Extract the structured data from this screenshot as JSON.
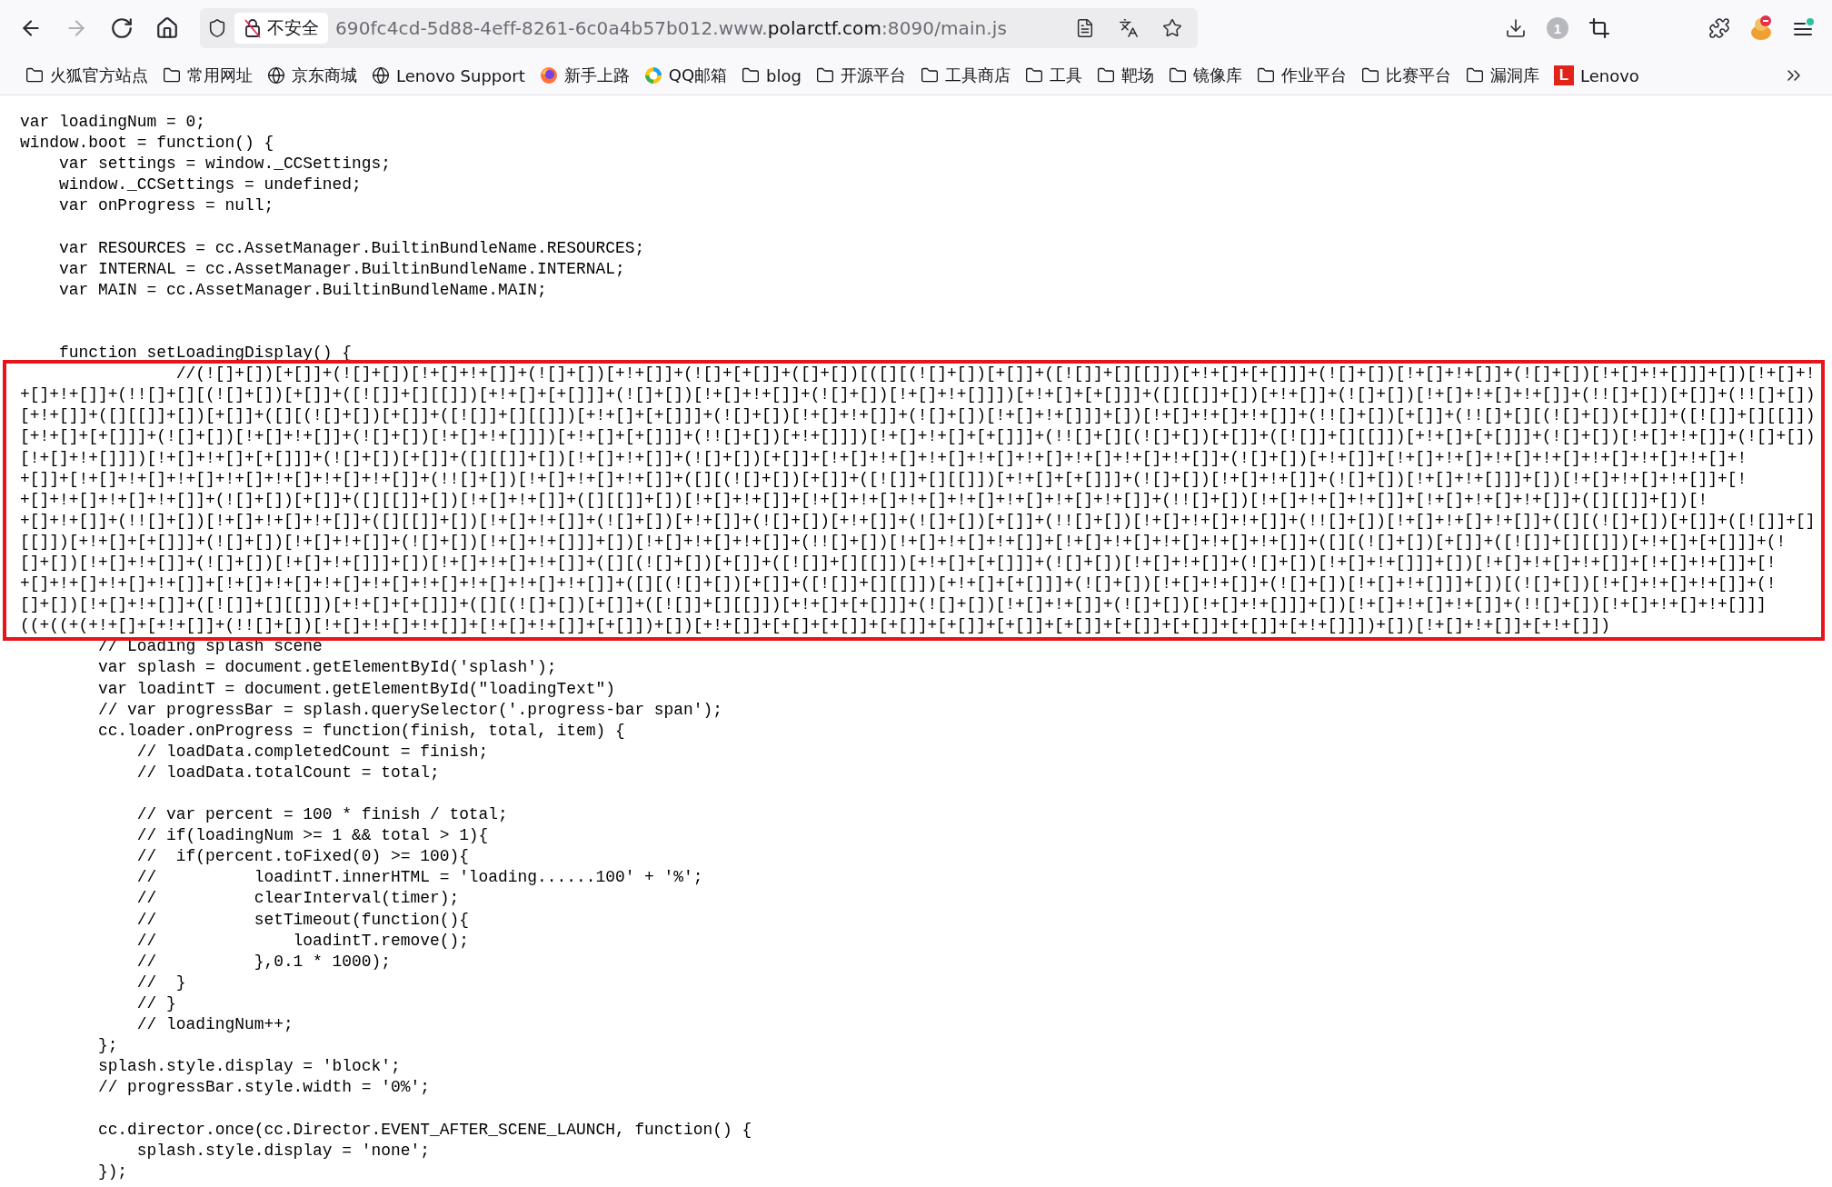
{
  "toolbar": {
    "nav_buttons": [
      {
        "kind": "back",
        "disabled": false
      },
      {
        "kind": "forward",
        "disabled": true
      },
      {
        "kind": "reload",
        "disabled": false
      },
      {
        "kind": "home",
        "disabled": false
      }
    ],
    "address_bar": {
      "security_label": "不安全",
      "url_prefix": "690fc4cd-5d88-4eff-8261-6c0a4b57b012.www.",
      "url_domain": "polarctf.com",
      "url_suffix": ":8090/main.js"
    },
    "downloads_count": "1"
  },
  "bookmarks": [
    {
      "kind": "folder",
      "label": "火狐官方站点"
    },
    {
      "kind": "folder",
      "label": "常用网址"
    },
    {
      "kind": "globe",
      "label": "京东商城"
    },
    {
      "kind": "globe",
      "label": "Lenovo Support"
    },
    {
      "kind": "firefox",
      "label": "新手上路"
    },
    {
      "kind": "mail",
      "label": "QQ邮箱"
    },
    {
      "kind": "folder",
      "label": "blog"
    },
    {
      "kind": "folder",
      "label": "开源平台"
    },
    {
      "kind": "folder",
      "label": "工具商店"
    },
    {
      "kind": "folder",
      "label": "工具"
    },
    {
      "kind": "folder",
      "label": "靶场"
    },
    {
      "kind": "folder",
      "label": "镜像库"
    },
    {
      "kind": "folder",
      "label": "作业平台"
    },
    {
      "kind": "folder",
      "label": "比赛平台"
    },
    {
      "kind": "folder",
      "label": "漏洞库"
    },
    {
      "kind": "lenovo",
      "label": "Lenovo",
      "logo": "L"
    }
  ],
  "code": {
    "before": [
      {
        "kind": "code",
        "text": "var loadingNum = 0;"
      },
      {
        "kind": "code",
        "text": "window.boot = function() {"
      },
      {
        "kind": "code",
        "text": "    var settings = window._CCSettings;"
      },
      {
        "kind": "code",
        "text": "    window._CCSettings = undefined;"
      },
      {
        "kind": "code",
        "text": "    var onProgress = null;"
      },
      {
        "kind": "blank"
      },
      {
        "kind": "code",
        "text": "    var RESOURCES = cc.AssetManager.BuiltinBundleName.RESOURCES;"
      },
      {
        "kind": "code",
        "text": "    var INTERNAL = cc.AssetManager.BuiltinBundleName.INTERNAL;"
      },
      {
        "kind": "code",
        "text": "    var MAIN = cc.AssetManager.BuiltinBundleName.MAIN;"
      },
      {
        "kind": "blank"
      },
      {
        "kind": "blank"
      },
      {
        "kind": "code",
        "text": "    function setLoadingDisplay() {"
      }
    ],
    "highlighted": [
      {
        "kind": "code",
        "text": "                //(![]+[])[+[]]+(![]+[])[!+[]+!+[]]+(![]+[])[+!+[]]+(![]+[+[]]+([]+[])[([][(![]+[])[+[]]+([![]]+[][[]])[+!+[]+[+[]]]+(![]+[])[!+[]+!+[]]+(![]+[])[!+[]+!+[]]]+[])[!+[]+!"
      },
      {
        "kind": "code",
        "text": "+[]+!+[]]+(!![]+[][(![]+[])[+[]]+([![]]+[][[]])[+!+[]+[+[]]]+(![]+[])[!+[]+!+[]]+(![]+[])[!+[]+!+[]]])[+!+[]+[+[]]]+([][[]]+[])[+!+[]]+(![]+[])[!+[]+!+[]+!+[]]+(!![]+[])[+[]]+(!![]+[])"
      },
      {
        "kind": "code",
        "text": "[+!+[]]+([][[]]+[])[+[]]+([][(![]+[])[+[]]+([![]]+[][[]])[+!+[]+[+[]]]+(![]+[])[!+[]+!+[]]+(![]+[])[!+[]+!+[]]]+[])[!+[]+!+[]+!+[]]+(!![]+[])[+[]]+(!![]+[][(![]+[])[+[]]+([![]]+[][[]])"
      },
      {
        "kind": "code",
        "text": "[+!+[]+[+[]]]+(![]+[])[!+[]+!+[]]+(![]+[])[!+[]+!+[]]])[+!+[]+[+[]]]+(!![]+[])[+!+[]]])[!+[]+!+[]+[+[]]]+(!![]+[][(![]+[])[+[]]+([![]]+[][[]])[+!+[]+[+[]]]+(![]+[])[!+[]+!+[]]+(![]+[])"
      },
      {
        "kind": "code",
        "text": "[!+[]+!+[]]])[!+[]+!+[]+[+[]]]+(![]+[])[+[]]+([][[]]+[])[!+[]+!+[]]+(![]+[])[+[]]+[!+[]+!+[]+!+[]+!+[]+!+[]+!+[]+!+[]+!+[]]+(![]+[])[+!+[]]+[!+[]+!+[]+!+[]+!+[]+!+[]+!+[]+!+[]+!"
      },
      {
        "kind": "code",
        "text": "+[]]+[!+[]+!+[]+!+[]+!+[]+!+[]+!+[]+!+[]]+(!![]+[])[!+[]+!+[]+!+[]]+([][(![]+[])[+[]]+([![]]+[][[]])[+!+[]+[+[]]]+(![]+[])[!+[]+!+[]]+(![]+[])[!+[]+!+[]]]+[])[!+[]+!+[]+!+[]]+[!"
      },
      {
        "kind": "code",
        "text": "+[]+!+[]+!+[]+!+[]]+(![]+[])[+[]]+([][[]]+[])[!+[]+!+[]]+([][[]]+[])[!+[]+!+[]]+[!+[]+!+[]+!+[]+!+[]+!+[]+!+[]+!+[]]+(!![]+[])[!+[]+!+[]+!+[]]+[!+[]+!+[]+!+[]]+([][[]]+[])[!"
      },
      {
        "kind": "code",
        "text": "+[]+!+[]]+(!![]+[])[!+[]+!+[]+!+[]]+([][[]]+[])[!+[]+!+[]]+(![]+[])[+!+[]]+(![]+[])[+!+[]]+(![]+[])[+[]]+(!![]+[])[!+[]+!+[]+!+[]]+(!![]+[])[!+[]+!+[]+!+[]]+([][(![]+[])[+[]]+([![]]+[]"
      },
      {
        "kind": "code",
        "text": "[[]])[+!+[]+[+[]]]+(![]+[])[!+[]+!+[]]+(![]+[])[!+[]+!+[]]]+[])[!+[]+!+[]+!+[]]+(!![]+[])[!+[]+!+[]+!+[]]+[!+[]+!+[]+!+[]+!+[]+!+[]]+([][(![]+[])[+[]]+([![]]+[][[]])[+!+[]+[+[]]]+(!"
      },
      {
        "kind": "code",
        "text": "[]+[])[!+[]+!+[]]+(![]+[])[!+[]+!+[]]]+[])[!+[]+!+[]+!+[]]+([][(![]+[])[+[]]+([![]]+[][[]])[+!+[]+[+[]]]+(![]+[])[!+[]+!+[]]+(![]+[])[!+[]+!+[]]]+[])[!+[]+!+[]+!+[]]+[!+[]+!+[]]+[!"
      },
      {
        "kind": "code",
        "text": "+[]+!+[]+!+[]+!+[]]+[!+[]+!+[]+!+[]+!+[]+!+[]+!+[]+!+[]+!+[]]+([][(![]+[])[+[]]+([![]]+[][[]])[+!+[]+[+[]]]+(![]+[])[!+[]+!+[]]+(![]+[])[!+[]+!+[]]]+[])[(![]+[])[!+[]+!+[]+!+[]]+(!"
      },
      {
        "kind": "code",
        "text": "[]+[])[!+[]+!+[]]+([![]]+[][[]])[+!+[]+[+[]]]+([][(![]+[])[+[]]+([![]]+[][[]])[+!+[]+[+[]]]+(![]+[])[!+[]+!+[]]+(![]+[])[!+[]+!+[]]]+[])[!+[]+!+[]+!+[]]+(!![]+[])[!+[]+!+[]+!+[]]]"
      },
      {
        "kind": "code",
        "text": "((+((+(+!+[]+[+!+[]]+(!![]+[])[!+[]+!+[]+!+[]]+[!+[]+!+[]]+[+[]])+[])[+!+[]]+[+[]+[+[]]+[+[]]+[+[]]+[+[]]+[+[]]+[+[]]+[+[]]+[+[]]+[+!+[]]])+[])[!+[]+!+[]]+[+!+[]])"
      }
    ],
    "after": [
      {
        "kind": "code",
        "text": "        // Loading splash scene"
      },
      {
        "kind": "code",
        "text": "        var splash = document.getElementById('splash');"
      },
      {
        "kind": "code",
        "text": "        var loadintT = document.getElementById(\"loadingText\")"
      },
      {
        "kind": "code",
        "text": "        // var progressBar = splash.querySelector('.progress-bar span');"
      },
      {
        "kind": "code",
        "text": "        cc.loader.onProgress = function(finish, total, item) {"
      },
      {
        "kind": "code",
        "text": "            // loadData.completedCount = finish;"
      },
      {
        "kind": "code",
        "text": "            // loadData.totalCount = total;"
      },
      {
        "kind": "blank"
      },
      {
        "kind": "code",
        "text": "            // var percent = 100 * finish / total;"
      },
      {
        "kind": "code",
        "text": "            // if(loadingNum >= 1 && total > 1){"
      },
      {
        "kind": "code",
        "text": "            //  if(percent.toFixed(0) >= 100){"
      },
      {
        "kind": "code",
        "text": "            //          loadintT.innerHTML = 'loading......100' + '%';"
      },
      {
        "kind": "code",
        "text": "            //          clearInterval(timer);"
      },
      {
        "kind": "code",
        "text": "            //          setTimeout(function(){"
      },
      {
        "kind": "code",
        "text": "            //              loadintT.remove();"
      },
      {
        "kind": "code",
        "text": "            //          },0.1 * 1000);"
      },
      {
        "kind": "code",
        "text": "            //  }"
      },
      {
        "kind": "code",
        "text": "            // }"
      },
      {
        "kind": "code",
        "text": "            // loadingNum++;"
      },
      {
        "kind": "code",
        "text": "        };"
      },
      {
        "kind": "code",
        "text": "        splash.style.display = 'block';"
      },
      {
        "kind": "code",
        "text": "        // progressBar.style.width = '0%';"
      },
      {
        "kind": "blank"
      },
      {
        "kind": "code",
        "text": "        cc.director.once(cc.Director.EVENT_AFTER_SCENE_LAUNCH, function() {"
      },
      {
        "kind": "code",
        "text": "            splash.style.display = 'none';"
      },
      {
        "kind": "code",
        "text": "        });"
      }
    ]
  }
}
